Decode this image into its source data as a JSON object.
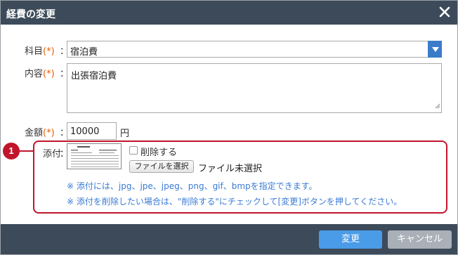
{
  "dialog": {
    "title": "経費の変更",
    "close_icon": "close-icon"
  },
  "form": {
    "subject": {
      "label": "科目",
      "required": "(*)",
      "colon": "：",
      "value": "宿泊費",
      "icon": "chevron-down-icon"
    },
    "content": {
      "label": "内容",
      "required": "(*)",
      "colon": "：",
      "value": "出張宿泊費"
    },
    "amount": {
      "label": "金額",
      "required": "(*)",
      "colon": "：",
      "value": "10000",
      "unit": "円"
    },
    "attachment": {
      "label": "添付",
      "colon": "：",
      "delete_label": "削除する",
      "delete_checked": false,
      "file_button": "ファイルを選択",
      "file_status": "ファイル未選択",
      "note1": "※ 添付には、jpg、jpe、jpeg、png、gif、bmpを指定できます。",
      "note2": "※ 添付を削除したい場合は、\"削除する\"にチェックして[変更]ボタンを押してください。"
    }
  },
  "callout": {
    "number": "1",
    "color": "#c0162b"
  },
  "footer": {
    "submit_label": "変更",
    "cancel_label": "キャンセル"
  },
  "colors": {
    "titlebar": "#3d4a59",
    "primary": "#4a9be8",
    "secondary": "#a9b0b8",
    "required": "#e65c00",
    "note": "#3a7bd5"
  }
}
